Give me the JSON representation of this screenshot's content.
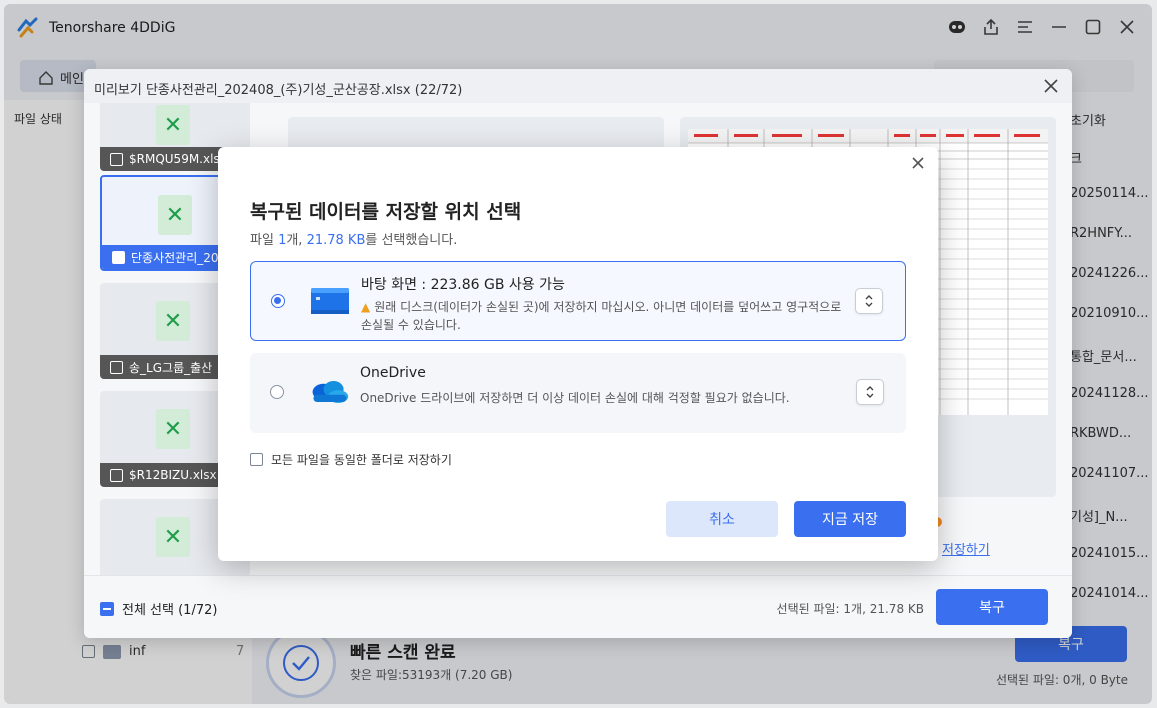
{
  "app": {
    "title": "Tenorshare 4DDiG",
    "home_tab": "메인",
    "file_status": "파일 상태",
    "right_header": "초기화",
    "right_sub": "크",
    "right_list": [
      "20250114...",
      "R2HNFY...",
      "20241226...",
      "20210910...",
      "통합_문서...",
      "20241128...",
      "RKBWD...",
      "20241107...",
      "기성]_N...",
      "20241015...",
      "20241014..."
    ],
    "tree_items": [
      {
        "label": "inf",
        "count": "7"
      }
    ],
    "status_title": "빠른 스캔 완료",
    "status_sub": "찾은 파일:53193개 (7.20 GB)",
    "recover_button": "복구",
    "selected_info": "선택된 파일: 0개, 0 Byte"
  },
  "preview": {
    "title": "미리보기 단종사전관리_202408_(주)기성_군산공장.xlsx (22/72)",
    "thumbs": [
      {
        "label": "$RMQU59M.xlsx",
        "checked": false
      },
      {
        "label": "단종사전관리_202408",
        "checked": true
      },
      {
        "label": "송_LG그룹_출산",
        "checked": false
      },
      {
        "label": "$R12BIZU.xlsx",
        "checked": false
      },
      {
        "label": "",
        "checked": false
      }
    ],
    "save_link": "저장하기",
    "select_all": "전체 선택 (1/72)",
    "selected_info": "선택된 파일: 1개, 21.78 KB",
    "recover_button": "복구"
  },
  "dialog": {
    "title": "복구된 데이터를 저장할 위치 선택",
    "subtitle_prefix": "파일 ",
    "subtitle_count": "1",
    "subtitle_mid": "개, ",
    "subtitle_size": "21.78 KB",
    "subtitle_suffix": "를 선택했습니다.",
    "options": [
      {
        "name": "바탕 화면 : 223.86 GB 사용 가능",
        "desc": "원래 디스크(데이터가 손실된 곳)에 저장하지 마십시오. 아니면 데이터를 덮어쓰고 영구적으로 손실될 수 있습니다.",
        "selected": true,
        "icon": "desktop-icon"
      },
      {
        "name": "OneDrive",
        "desc": "OneDrive 드라이브에 저장하면 더 이상 데이터 손실에 대해 걱정할 필요가 없습니다.",
        "selected": false,
        "icon": "onedrive-icon"
      }
    ],
    "same_folder": "모든 파일을 동일한 폴더로 저장하기",
    "cancel": "취소",
    "save_now": "지금 저장"
  },
  "colors": {
    "accent": "#3a6ff0",
    "warning": "#f0a020",
    "excel_green": "#1e9d4a"
  }
}
